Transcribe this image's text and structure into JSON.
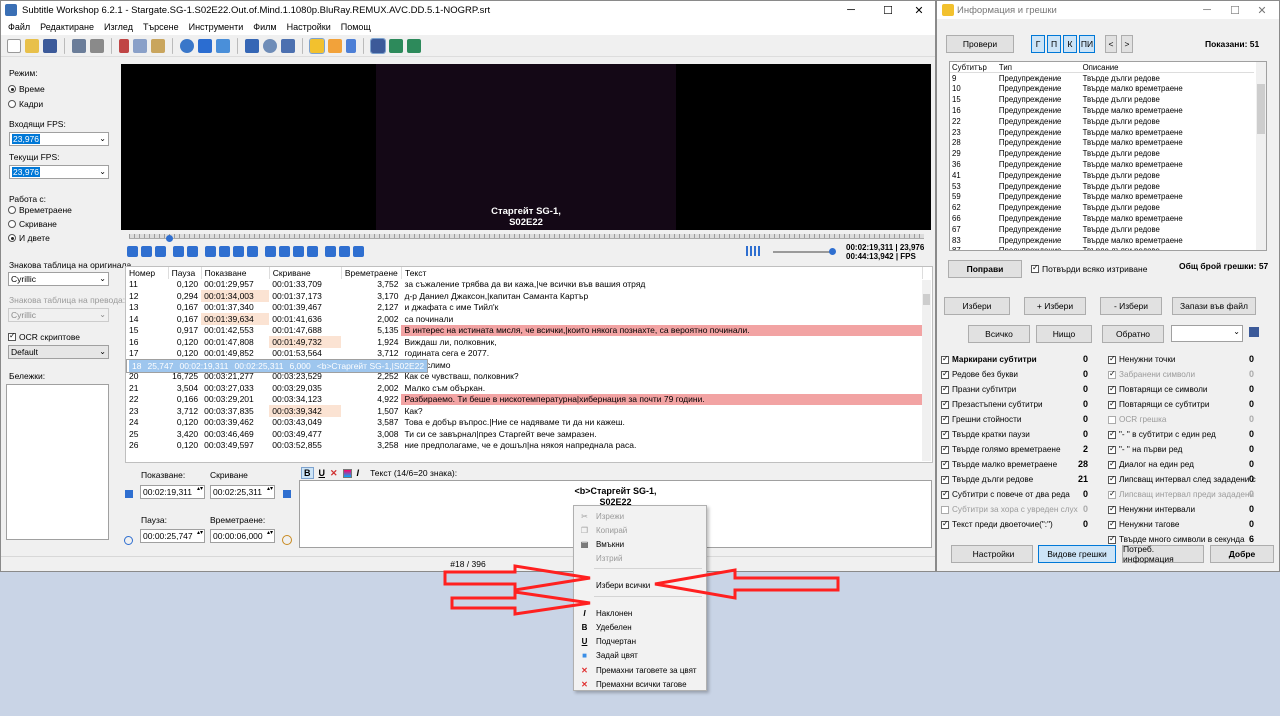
{
  "main_window": {
    "title": "Subtitle Workshop 6.2.1 - Stargate.SG-1.S02E22.Out.of.Mind.1.1080p.BluRay.REMUX.AVC.DD.5.1-NOGRP.srt",
    "menu": [
      "Файл",
      "Редактиране",
      "Изглед",
      "Търсене",
      "Инструменти",
      "Филм",
      "Настройки",
      "Помощ"
    ]
  },
  "left_panel": {
    "mode_label": "Режим:",
    "mode_time": "Време",
    "mode_frames": "Кадри",
    "input_fps_label": "Входящи FPS:",
    "input_fps": "23,976",
    "current_fps_label": "Текущи FPS:",
    "current_fps": "23,976",
    "work_with_label": "Работа с:",
    "work_duration": "Времетраене",
    "work_hide": "Скриване",
    "work_both": "И двете",
    "charset_orig_label": "Знакова таблица на оригинала",
    "charset_orig": "Cyrillic",
    "charset_trans_label": "Знакова таблица на превода:",
    "charset_trans": "Cyrillic",
    "ocr_label": "OCR скриптове",
    "ocr_value": "Default",
    "notes_label": "Бележки:"
  },
  "video": {
    "subtitle_line1": "Старгейт SG-1,",
    "subtitle_line2": "S02E22",
    "time_current": "00:02:19,311",
    "time_total": "00:44:13,942",
    "fps_value": "23,976",
    "fps_label": "FPS"
  },
  "grid": {
    "headers": [
      "Номер",
      "Пауза",
      "Показване",
      "Скриване",
      "Времетраене",
      "Текст"
    ],
    "rows": [
      {
        "n": "11",
        "pause": "0,120",
        "show": "00:01:29,957",
        "hide": "00:01:33,709",
        "dur": "3,752",
        "text": "за съжаление трябва да ви кажа,|че всички във вашия отряд",
        "hl": ""
      },
      {
        "n": "12",
        "pause": "0,294",
        "show": "00:01:34,003",
        "hide": "00:01:37,173",
        "dur": "3,170",
        "text": "д-р Даниел Джаксон,|капитан Саманта Картър",
        "hl": ""
      },
      {
        "n": "13",
        "pause": "0,167",
        "show": "00:01:37,340",
        "hide": "00:01:39,467",
        "dur": "2,127",
        "text": "и джафата с име Тийл'к",
        "hl": ""
      },
      {
        "n": "14",
        "pause": "0,167",
        "show": "00:01:39,634",
        "hide": "00:01:41,636",
        "dur": "2,002",
        "text": "са починали",
        "hl": ""
      },
      {
        "n": "15",
        "pause": "0,917",
        "show": "00:01:42,553",
        "hide": "00:01:47,688",
        "dur": "5,135",
        "text": "В интерес на истината мисля, че всички,|които някога познахте, са вероятно починали.",
        "hl": "pink"
      },
      {
        "n": "16",
        "pause": "0,120",
        "show": "00:01:47,808",
        "hide": "00:01:49,732",
        "dur": "1,924",
        "text": "Виждаш ли, полковник,",
        "hl": "peach"
      },
      {
        "n": "17",
        "pause": "0,120",
        "show": "00:01:49,852",
        "hide": "00:01:53,564",
        "dur": "3,712",
        "text": "годината сега е 2077.",
        "hl": ""
      },
      {
        "n": "18",
        "pause": "25,747",
        "show": "00:02:19,311",
        "hide": "00:02:25,311",
        "dur": "6,000",
        "text": "<b>Старгейт SG-1,|S02E22",
        "hl": "sel"
      },
      {
        "n": "19",
        "pause": "34,611",
        "show": "00:02:59,922",
        "hide": "00:03:04,552",
        "dur": "4,630",
        "text": "Немислимо",
        "hl": ""
      },
      {
        "n": "20",
        "pause": "16,725",
        "show": "00:03:21,277",
        "hide": "00:03:23,529",
        "dur": "2,252",
        "text": "Как се чувстваш, полковник?",
        "hl": ""
      },
      {
        "n": "21",
        "pause": "3,504",
        "show": "00:03:27,033",
        "hide": "00:03:29,035",
        "dur": "2,002",
        "text": "Малко съм объркан.",
        "hl": ""
      },
      {
        "n": "22",
        "pause": "0,166",
        "show": "00:03:29,201",
        "hide": "00:03:34,123",
        "dur": "4,922",
        "text": "Разбираемо. Ти беше в нискотемпературна|хибернация за почти 79 години.",
        "hl": "pink"
      },
      {
        "n": "23",
        "pause": "3,712",
        "show": "00:03:37,835",
        "hide": "00:03:39,342",
        "dur": "1,507",
        "text": "Как?",
        "hl": "peach"
      },
      {
        "n": "24",
        "pause": "0,120",
        "show": "00:03:39,462",
        "hide": "00:03:43,049",
        "dur": "3,587",
        "text": "Това е добър въпрос.|Ние се надяваме ти да ни кажеш.",
        "hl": ""
      },
      {
        "n": "25",
        "pause": "3,420",
        "show": "00:03:46,469",
        "hide": "00:03:49,477",
        "dur": "3,008",
        "text": "Ти си се завърнал|през Старгейт вече замразен.",
        "hl": ""
      },
      {
        "n": "26",
        "pause": "0,120",
        "show": "00:03:49,597",
        "hide": "00:03:52,855",
        "dur": "3,258",
        "text": "ние предполагаме, че е дошъл|на някоя напреднала раса.",
        "hl": ""
      }
    ]
  },
  "edit": {
    "show_label": "Показване:",
    "hide_label": "Скриване",
    "show_value": "00:02:19,311",
    "hide_value": "00:02:25,311",
    "pause_label": "Пауза:",
    "duration_label": "Времетраене:",
    "pause_value": "00:00:25,747",
    "duration_value": "00:00:06,000",
    "text_label": "Текст (14/6=20 знака):",
    "text_line1": "<b>Старгейт SG-1,",
    "text_line2": "S02E22",
    "status": "#18 / 396"
  },
  "context_menu": {
    "items": [
      {
        "label": "Изрежи",
        "disabled": true,
        "icon": "cut-icon"
      },
      {
        "label": "Копирай",
        "disabled": true,
        "icon": "copy-icon"
      },
      {
        "label": "Вмъкни",
        "disabled": false,
        "icon": "paste-icon"
      },
      {
        "label": "Изтрий",
        "disabled": true,
        "icon": "delete-icon"
      },
      {
        "label": "Избери всички",
        "disabled": false,
        "icon": ""
      },
      {
        "label": "Наклонен",
        "disabled": false,
        "icon": "italic-icon"
      },
      {
        "label": "Удебелен",
        "disabled": false,
        "icon": "bold-icon"
      },
      {
        "label": "Подчертан",
        "disabled": false,
        "icon": "underline-icon"
      },
      {
        "label": "Задай цвят",
        "disabled": false,
        "icon": "color-icon"
      },
      {
        "label": "Премахни таговете за цвят",
        "disabled": false,
        "icon": "remove-color-icon"
      },
      {
        "label": "Премахни всички тагове",
        "disabled": false,
        "icon": "remove-tags-icon"
      }
    ]
  },
  "info_window": {
    "title": "Информация и грешки",
    "check_button": "Провери",
    "filter_buttons": [
      "Г",
      "П",
      "К",
      "ПИ"
    ],
    "shown_label": "Показани: 51",
    "columns": [
      "Субтитър",
      "Тип",
      "Описание"
    ],
    "rows": [
      [
        "9",
        "Предупреждение",
        "Твърде дълги редове"
      ],
      [
        "10",
        "Предупреждение",
        "Твърде малко времетраене"
      ],
      [
        "15",
        "Предупреждение",
        "Твърде дълги редове"
      ],
      [
        "16",
        "Предупреждение",
        "Твърде малко времетраене"
      ],
      [
        "22",
        "Предупреждение",
        "Твърде дълги редове"
      ],
      [
        "23",
        "Предупреждение",
        "Твърде малко времетраене"
      ],
      [
        "28",
        "Предупреждение",
        "Твърде малко времетраене"
      ],
      [
        "29",
        "Предупреждение",
        "Твърде дълги редове"
      ],
      [
        "36",
        "Предупреждение",
        "Твърде малко времетраене"
      ],
      [
        "41",
        "Предупреждение",
        "Твърде дълги редове"
      ],
      [
        "53",
        "Предупреждение",
        "Твърде дълги редове"
      ],
      [
        "59",
        "Предупреждение",
        "Твърде малко времетраене"
      ],
      [
        "62",
        "Предупреждение",
        "Твърде дълги редове"
      ],
      [
        "66",
        "Предупреждение",
        "Твърде малко времетраене"
      ],
      [
        "67",
        "Предупреждение",
        "Твърде дълги редове"
      ],
      [
        "83",
        "Предупреждение",
        "Твърде малко времетраене"
      ],
      [
        "87",
        "Предупреждение",
        "Твърде дълги редове"
      ]
    ],
    "fix_button": "Поправи",
    "confirm_delete": "Потвърди всяко изтриване",
    "total_errors": "Общ брой грешки: 57",
    "select_button": "Избери",
    "plus_select": "+ Избери",
    "minus_select": "- Избери",
    "save_file": "Запази във файл",
    "all_button": "Всичко",
    "none_button": "Нищо",
    "invert_button": "Обратно",
    "left_checks": [
      {
        "label": "Маркирани субтитри",
        "count": "0",
        "checked": true,
        "disabled": false,
        "bold": true
      },
      {
        "label": "Редове без букви",
        "count": "0",
        "checked": true,
        "disabled": false
      },
      {
        "label": "Празни субтитри",
        "count": "0",
        "checked": true,
        "disabled": false
      },
      {
        "label": "Презастъпени субтитри",
        "count": "0",
        "checked": true,
        "disabled": false
      },
      {
        "label": "Грешни стойности",
        "count": "0",
        "checked": true,
        "disabled": false
      },
      {
        "label": "Твърде кратки паузи",
        "count": "0",
        "checked": true,
        "disabled": false
      },
      {
        "label": "Твърде голямо времетраене",
        "count": "2",
        "checked": true,
        "disabled": false
      },
      {
        "label": "Твърде малко времетраене",
        "count": "28",
        "checked": true,
        "disabled": false
      },
      {
        "label": "Твърде дълги редове",
        "count": "21",
        "checked": true,
        "disabled": false
      },
      {
        "label": "Субтитри с повече от два реда",
        "count": "0",
        "checked": true,
        "disabled": false
      },
      {
        "label": "Субтитри за хора с увреден слух",
        "count": "0",
        "checked": false,
        "disabled": true
      },
      {
        "label": "Текст преди двоеточие(\":\")",
        "count": "0",
        "checked": true,
        "disabled": false
      }
    ],
    "right_checks": [
      {
        "label": "Ненужни точки",
        "count": "0",
        "checked": true,
        "disabled": false
      },
      {
        "label": "Забранени символи",
        "count": "0",
        "checked": true,
        "disabled": true
      },
      {
        "label": "Повтарящи се символи",
        "count": "0",
        "checked": true,
        "disabled": false
      },
      {
        "label": "Повтарящи се субтитри",
        "count": "0",
        "checked": true,
        "disabled": false
      },
      {
        "label": "OCR грешка",
        "count": "0",
        "checked": false,
        "disabled": true
      },
      {
        "label": "\"- \" в субтитри с един ред",
        "count": "0",
        "checked": true,
        "disabled": false
      },
      {
        "label": "\"- \" на първи ред",
        "count": "0",
        "checked": true,
        "disabled": false
      },
      {
        "label": "Диалог на един ред",
        "count": "0",
        "checked": true,
        "disabled": false
      },
      {
        "label": "Липсващ интервал след зададени с",
        "count": "0",
        "checked": true,
        "disabled": false
      },
      {
        "label": "Липсващ интервал преди зададени",
        "count": "0",
        "checked": true,
        "disabled": true
      },
      {
        "label": "Ненужни интервали",
        "count": "0",
        "checked": true,
        "disabled": false
      },
      {
        "label": "Ненужни тагове",
        "count": "0",
        "checked": true,
        "disabled": false
      },
      {
        "label": "Твърде много символи в секунда",
        "count": "6",
        "checked": true,
        "disabled": false
      }
    ],
    "settings_button": "Настройки",
    "error_types_button": "Видове грешки",
    "user_info_button": "Потреб. информация",
    "ok_button": "Добре"
  }
}
